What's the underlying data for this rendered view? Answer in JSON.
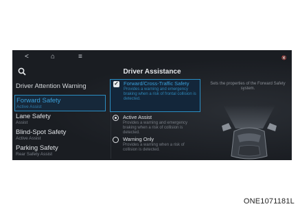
{
  "screen": {
    "nav": {
      "back": "<",
      "home": "⌂",
      "menu": "≡",
      "status": "🔇"
    },
    "title": "Driver Assistance",
    "left_panel": {
      "heading": "Driver Attention Warning",
      "items": [
        {
          "label": "Forward Safety",
          "sub": "Active Assist",
          "selected": true
        },
        {
          "label": "Lane Safety",
          "sub": "Assist",
          "selected": false
        },
        {
          "label": "Blind-Spot Safety",
          "sub": "Active Assist",
          "selected": false
        },
        {
          "label": "Parking Safety",
          "sub": "Rear Safety Assist",
          "selected": false
        }
      ]
    },
    "options": [
      {
        "type": "checkbox",
        "checked": true,
        "label": "Forward/Cross-Traffic Safety",
        "desc": "Provides a warning and emergency braking when a risk of frontal collision is detected.",
        "selected": true
      },
      {
        "type": "radio",
        "checked": true,
        "label": "Active Assist",
        "desc": "Provides a warning and emergency braking when a risk of collision is detected.",
        "selected": false
      },
      {
        "type": "radio",
        "checked": false,
        "label": "Warning Only",
        "desc": "Provides a warning when a risk of collision is detected.",
        "selected": false
      }
    ],
    "preview_text": "Sets the properties of the Forward Safety system.",
    "colors": {
      "accent": "#2c8fc4",
      "background": "#1a1d22"
    }
  },
  "caption": "ONE1071181L"
}
